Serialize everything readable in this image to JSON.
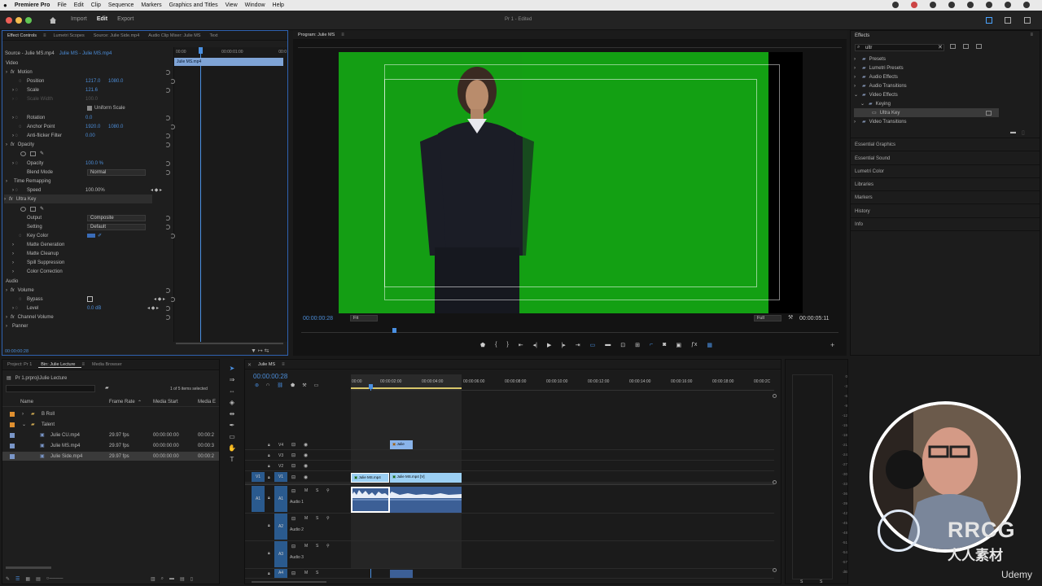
{
  "menubar": {
    "app": "Premiere Pro",
    "items": [
      "File",
      "Edit",
      "Clip",
      "Sequence",
      "Markers",
      "Graphics and Titles",
      "View",
      "Window",
      "Help"
    ]
  },
  "header": {
    "nav": [
      "Import",
      "Edit",
      "Export"
    ],
    "active": "Edit",
    "doc_title": "Pr 1 - Edited"
  },
  "effect_controls": {
    "tabs": [
      "Effect Controls",
      "Lumetri Scopes",
      "Source: Julie Side.mp4",
      "Audio Clip Mixer: Julie MS",
      "Text"
    ],
    "source": "Source - Julie MS.mp4",
    "sequence": "Julie MS - Julie MS.mp4",
    "ruler": [
      "00:00",
      "00:00:01:00",
      "00:0"
    ],
    "clip": "Julie MS.mp4",
    "timecode": "00:00:00:28",
    "video_label": "Video",
    "motion": "Motion",
    "position_label": "Position",
    "position_x": "1217.0",
    "position_y": "1080.0",
    "scale_label": "Scale",
    "scale": "121.6",
    "scale_width_label": "Scale Width",
    "scale_width": "100.0",
    "uniform_scale": "Uniform Scale",
    "rotation_label": "Rotation",
    "rotation": "0.0",
    "anchor_label": "Anchor Point",
    "anchor_x": "1920.0",
    "anchor_y": "1080.0",
    "antiflicker_label": "Anti-flicker Filter",
    "antiflicker": "0.00",
    "opacity_hdr": "Opacity",
    "opacity_label": "Opacity",
    "opacity": "100.0 %",
    "blend_label": "Blend Mode",
    "blend": "Normal",
    "time_remap": "Time Remapping",
    "speed_label": "Speed",
    "speed": "100.00%",
    "ultra_key": "Ultra Key",
    "output_label": "Output",
    "output": "Composite",
    "setting_label": "Setting",
    "setting": "Default",
    "keycolor_label": "Key Color",
    "matte_gen": "Matte Generation",
    "matte_clean": "Matte Cleanup",
    "spill": "Spill Suppression",
    "color_corr": "Color Correction",
    "audio_label": "Audio",
    "volume": "Volume",
    "bypass": "Bypass",
    "level_label": "Level",
    "level": "0.0 dB",
    "channel_volume": "Channel Volume",
    "panner": "Panner"
  },
  "program": {
    "title": "Program: Julie MS",
    "timecode": "00:00:00:28",
    "fit": "Fit",
    "quality": "Full",
    "duration": "00:00:05:11"
  },
  "effects": {
    "title": "Effects",
    "search": "ultr",
    "tree": [
      "Presets",
      "Lumetri Presets",
      "Audio Effects",
      "Audio Transitions",
      "Video Effects",
      "Keying",
      "Ultra Key",
      "Video Transitions"
    ],
    "panels": [
      "Essential Graphics",
      "Essential Sound",
      "Lumetri Color",
      "Libraries",
      "Markers",
      "History",
      "Info"
    ]
  },
  "project": {
    "tabs": [
      "Project: Pr 1",
      "Bin: Julie Lecture",
      "Media Browser"
    ],
    "path": "Pr 1.prproj\\Julie Lecture",
    "count": "1 of 5 items selected",
    "columns": [
      "Name",
      "Frame Rate",
      "Media Start",
      "Media E"
    ],
    "rows": [
      {
        "name": "B Roll",
        "fr": "",
        "ms": "",
        "me": ""
      },
      {
        "name": "Talent",
        "fr": "",
        "ms": "",
        "me": ""
      },
      {
        "name": "Julie CU.mp4",
        "fr": "29.97 fps",
        "ms": "00:00:00:00",
        "me": "00:00:2"
      },
      {
        "name": "Julie MS.mp4",
        "fr": "29.97 fps",
        "ms": "00:00:00:00",
        "me": "00:00:3"
      },
      {
        "name": "Julie Side.mp4",
        "fr": "29.97 fps",
        "ms": "00:00:00:00",
        "me": "00:00:2"
      }
    ]
  },
  "timeline": {
    "title": "Julie MS",
    "timecode": "00:00:00:28",
    "ruler": [
      "00:00",
      "00:00:02:00",
      "00:00:04:00",
      "00:00:06:00",
      "00:00:08:00",
      "00:00:10:00",
      "00:00:12:00",
      "00:00:14:00",
      "00:00:16:00",
      "00:00:18:00",
      "00:00:2C"
    ],
    "vtracks": [
      "V4",
      "V3",
      "V2",
      "V1"
    ],
    "atracks": [
      "A1",
      "A2",
      "A3",
      "A4"
    ],
    "track_src_v": "V1",
    "track_src_a": "A1",
    "audio_names": [
      "Audio 1",
      "Audio 2",
      "Audio 3"
    ],
    "clip_v4": "Julie",
    "clip_v1a": "Julie MS.mp4",
    "clip_v1b": "Julie MS.mp4 [V]"
  },
  "meter": {
    "labels": [
      "0",
      "-3",
      "-6",
      "-9",
      "-12",
      "-15",
      "-18",
      "-21",
      "-24",
      "-27",
      "-30",
      "-33",
      "-36",
      "-39",
      "-42",
      "-45",
      "-48",
      "-51",
      "-54",
      "-57",
      "dB"
    ],
    "s1": "S",
    "s2": "S"
  },
  "watermark": {
    "text1": "RRCG",
    "text2": "人人素材",
    "brand": "Udemy"
  }
}
